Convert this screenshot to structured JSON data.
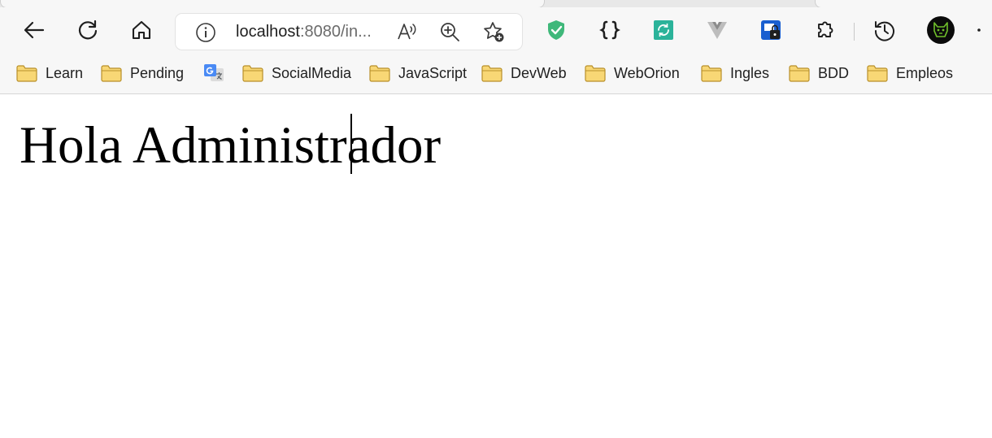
{
  "browser": {
    "address_bar": {
      "url_host": "localhost",
      "url_rest": ":8080/in..."
    },
    "toolbar_icons": [
      "back-icon",
      "refresh-icon",
      "home-icon",
      "site-info-icon",
      "read-aloud-icon",
      "zoom-icon",
      "add-favorite-icon",
      "adblock-shield-icon",
      "json-viewer-icon",
      "sync-extension-icon",
      "vue-devtools-icon",
      "password-manager-icon",
      "extensions-icon",
      "history-icon",
      "profile-avatar",
      "more-icon"
    ],
    "accent_colors": {
      "shield": "#3fb87a",
      "sync": "#2bb39a",
      "vue": "#a7a7a7",
      "lock": "#1a5fd0",
      "folder": "#f8d775"
    }
  },
  "bookmarks": [
    {
      "label": "Learn",
      "type": "folder"
    },
    {
      "label": "Pending",
      "type": "folder"
    },
    {
      "label": "",
      "type": "translate"
    },
    {
      "label": "SocialMedia",
      "type": "folder"
    },
    {
      "label": "JavaScript",
      "type": "folder"
    },
    {
      "label": "DevWeb",
      "type": "folder"
    },
    {
      "label": "WebOrion",
      "type": "folder"
    },
    {
      "label": "Ingles",
      "type": "folder"
    },
    {
      "label": "BDD",
      "type": "folder"
    },
    {
      "label": "Empleos",
      "type": "folder"
    }
  ],
  "page": {
    "heading": "Hola Administrador"
  }
}
